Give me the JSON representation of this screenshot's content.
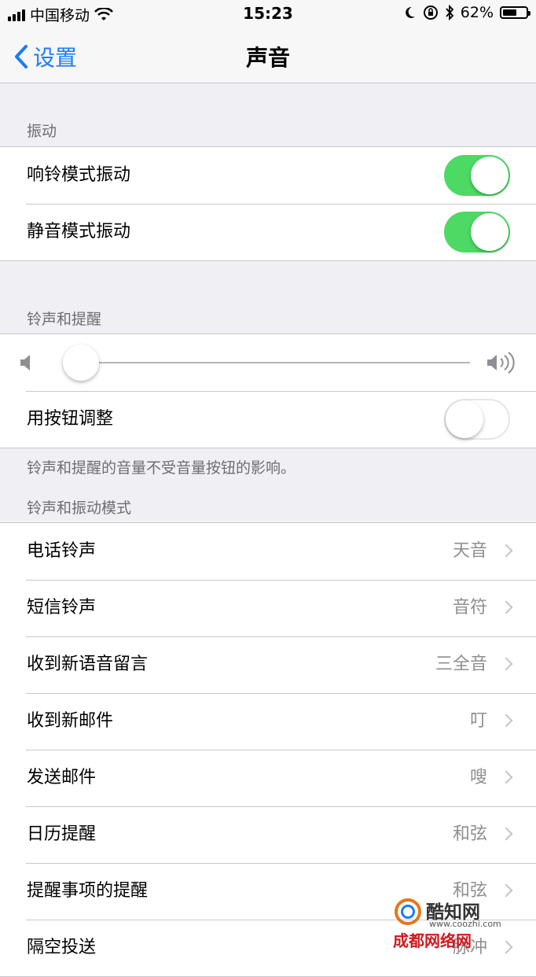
{
  "status_bar": {
    "carrier": "中国移动",
    "time": "15:23",
    "battery": "62%",
    "battery_level": 0.62
  },
  "nav": {
    "back_label": "设置",
    "title": "声音"
  },
  "vibration": {
    "header": "振动",
    "rows": [
      {
        "label": "响铃模式振动",
        "on": true
      },
      {
        "label": "静音模式振动",
        "on": true
      }
    ]
  },
  "ringer": {
    "header": "铃声和提醒",
    "volume_level": 0.0,
    "change_with_buttons": {
      "label": "用按钮调整",
      "on": false
    },
    "footer": "铃声和提醒的音量不受音量按钮的影响。"
  },
  "patterns": {
    "header": "铃声和振动模式",
    "rows": [
      {
        "label": "电话铃声",
        "value": "天音"
      },
      {
        "label": "短信铃声",
        "value": "音符"
      },
      {
        "label": "收到新语音留言",
        "value": "三全音"
      },
      {
        "label": "收到新邮件",
        "value": "叮"
      },
      {
        "label": "发送邮件",
        "value": "嗖"
      },
      {
        "label": "日历提醒",
        "value": "和弦"
      },
      {
        "label": "提醒事项的提醒",
        "value": "和弦"
      },
      {
        "label": "隔空投送",
        "value": "脉冲"
      }
    ]
  },
  "watermark": {
    "name": "酷知网",
    "url": "www.coozhi.com",
    "site": "成都网络网"
  },
  "colors": {
    "accent": "#1a7cf6",
    "toggle_on": "#4cd964"
  }
}
